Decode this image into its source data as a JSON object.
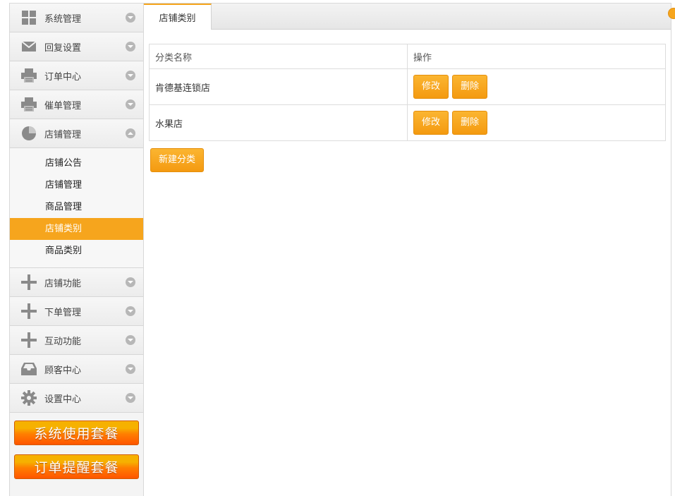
{
  "sidebar": {
    "items": [
      {
        "label": "系统管理",
        "icon": "grid-icon"
      },
      {
        "label": "回复设置",
        "icon": "mail-icon"
      },
      {
        "label": "订单中心",
        "icon": "printer-icon"
      },
      {
        "label": "催单管理",
        "icon": "printer-icon"
      },
      {
        "label": "店铺管理",
        "icon": "pie-chart-icon"
      }
    ],
    "submenu": [
      {
        "label": "店铺公告"
      },
      {
        "label": "店铺管理"
      },
      {
        "label": "商品管理"
      },
      {
        "label": "店铺类别",
        "active": true
      },
      {
        "label": "商品类别"
      }
    ],
    "items_after": [
      {
        "label": "店铺功能",
        "icon": "plus-icon"
      },
      {
        "label": "下单管理",
        "icon": "plus-icon"
      },
      {
        "label": "互动功能",
        "icon": "plus-icon"
      },
      {
        "label": "顾客中心",
        "icon": "inbox-icon"
      },
      {
        "label": "设置中心",
        "icon": "gear-icon"
      }
    ],
    "promos": [
      {
        "label": "系统使用套餐"
      },
      {
        "label": "订单提醒套餐"
      }
    ]
  },
  "main": {
    "tab": "店铺类别",
    "table": {
      "headers": [
        "分类名称",
        "操作"
      ],
      "rows": [
        {
          "name": "肯德基连锁店",
          "edit": "修改",
          "delete": "删除"
        },
        {
          "name": "水果店",
          "edit": "修改",
          "delete": "删除"
        }
      ]
    },
    "new_button": "新建分类"
  },
  "colors": {
    "accent": "#f6a51d",
    "promo_top": "#f6b100",
    "promo_bottom": "#ff5500"
  }
}
